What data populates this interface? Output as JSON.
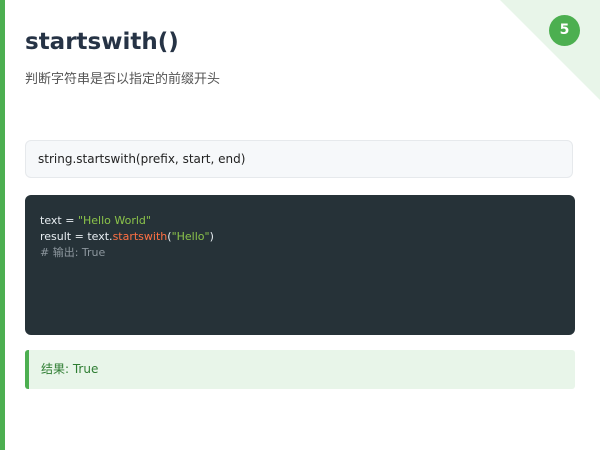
{
  "slide": {
    "page_number": "5",
    "title": "startswith()",
    "subtitle": "判断字符串是否以指定的前缀开头",
    "syntax": "string.startswith(prefix, start, end)",
    "code": {
      "line1": {
        "var": "text",
        "eq": " = ",
        "str": "\"Hello World\""
      },
      "line2": {
        "var": "result",
        "eq": " = ",
        "obj": "text.",
        "method": "startswith",
        "open": "(",
        "arg": "\"Hello\"",
        "close": ")"
      },
      "line3": {
        "comment": "# 输出: True"
      }
    },
    "result": "结果: True",
    "colors": {
      "accent": "#4caf50",
      "code_background": "#263238",
      "string": "#8bc34a",
      "method": "#ff7043",
      "comment": "#8d979e",
      "result_background": "#e8f5e9"
    }
  }
}
